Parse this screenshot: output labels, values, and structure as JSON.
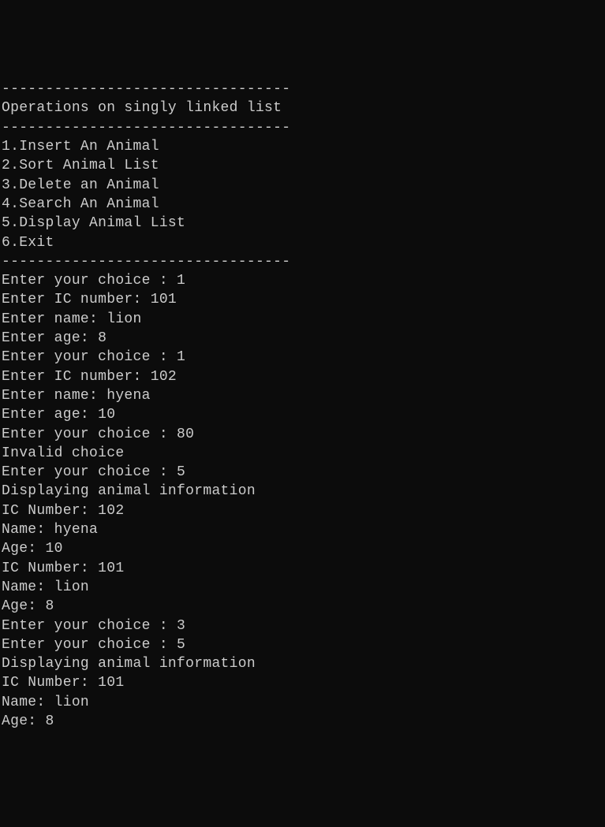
{
  "lines": [
    "---------------------------------",
    "Operations on singly linked list",
    "---------------------------------",
    "",
    "1.Insert An Animal",
    "2.Sort Animal List",
    "3.Delete an Animal",
    "4.Search An Animal",
    "5.Display Animal List",
    "6.Exit",
    "---------------------------------",
    "Enter your choice : 1",
    "Enter IC number: 101",
    "Enter name: lion",
    "Enter age: 8",
    "",
    "Enter your choice : 1",
    "Enter IC number: 102",
    "Enter name: hyena",
    "Enter age: 10",
    "",
    "Enter your choice : 80",
    "Invalid choice",
    "Enter your choice : 5",
    "",
    "Displaying animal information",
    "IC Number: 102",
    "Name: hyena",
    "Age: 10",
    "",
    "IC Number: 101",
    "Name: lion",
    "Age: 8",
    "",
    "Enter your choice : 3",
    "Enter your choice : 5",
    "",
    "Displaying animal information",
    "IC Number: 101",
    "Name: lion",
    "Age: 8"
  ]
}
